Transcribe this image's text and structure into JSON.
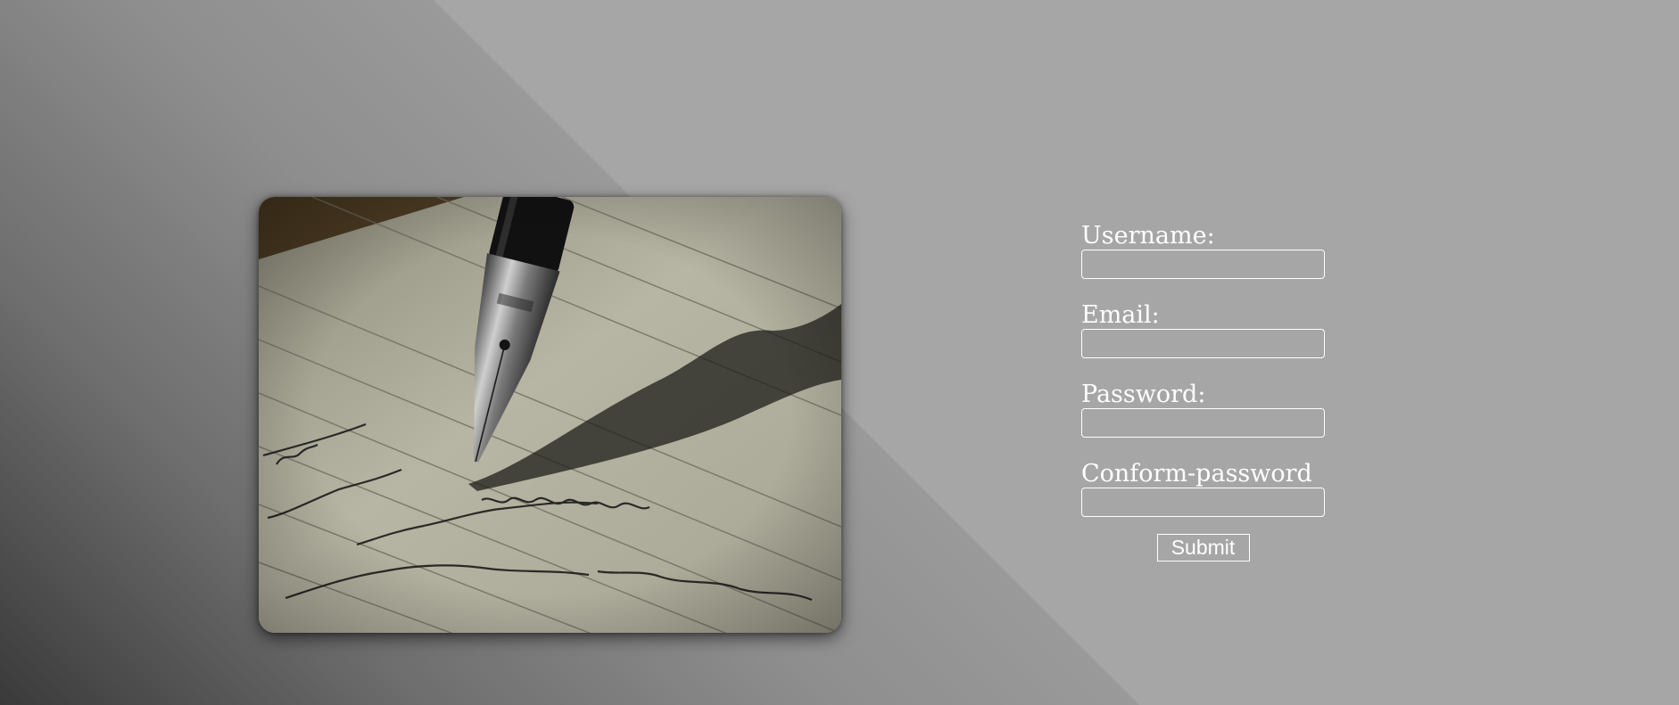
{
  "photo": {
    "subject": "fountain-pen-writing-on-lined-paper"
  },
  "form": {
    "username_label": "Username:",
    "email_label": "Email:",
    "password_label": "Password:",
    "confirm_label": "Conform-password",
    "username_value": "",
    "email_value": "",
    "password_value": "",
    "confirm_value": "",
    "submit_label": "Submit"
  },
  "colors": {
    "background": "#a6a6a6",
    "text": "#ffffff",
    "field_border": "#ffffff"
  }
}
